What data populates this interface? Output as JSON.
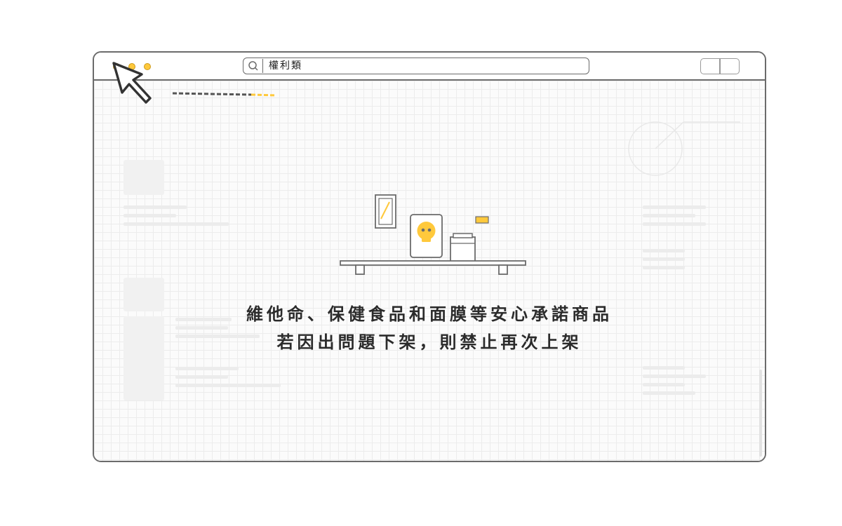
{
  "browser": {
    "address_bar": {
      "text": "權利類"
    }
  },
  "message": {
    "line_1": "維他命、保健食品和面膜等安心承諾商品",
    "line_2": "若因出問題下架，則禁止再次上架"
  },
  "colors": {
    "accent": "#ffc93c",
    "frame": "#6b6b6b",
    "text": "#2b2b2b"
  },
  "icons": {
    "cursor": "cursor-icon",
    "search": "search-icon",
    "skull": "skull-icon"
  }
}
